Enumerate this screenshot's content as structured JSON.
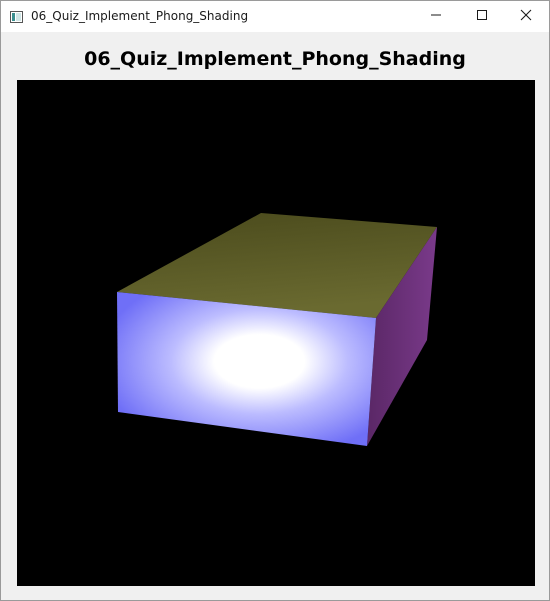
{
  "window": {
    "title": "06_Quiz_Implement_Phong_Shading",
    "controls": {
      "minimize_icon": "minimize-icon",
      "maximize_icon": "maximize-icon",
      "close_icon": "close-icon"
    }
  },
  "main": {
    "heading": "06_Quiz_Implement_Phong_Shading"
  },
  "scene": {
    "background": "#000000",
    "object": "box",
    "face_colors": {
      "front": "#7777ff",
      "top": "#5e5e28",
      "right": "#6a2c7a",
      "highlight": "#ffffff"
    }
  }
}
